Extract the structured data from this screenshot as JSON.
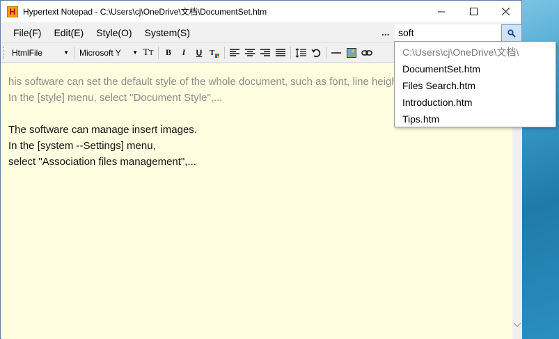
{
  "window": {
    "title": "Hypertext Notepad - C:\\Users\\cj\\OneDrive\\文档\\DocumentSet.htm",
    "icon_letter": "H"
  },
  "menu": [
    "File(F)",
    "Edit(E)",
    "Style(O)",
    "System(S)"
  ],
  "search": {
    "ellipsis": "...",
    "value": "soft"
  },
  "toolbar": {
    "file_type": "HtmlFile",
    "font": "Microsoft Y"
  },
  "content": {
    "lines": [
      "his software can set the default style of the whole document, such as font, line height, etc.",
      "In the [style] menu, select \"Document Style\",...",
      "",
      "The software can manage insert images.",
      "In the [system --Settings] menu,",
      "select \"Association files management\",..."
    ]
  },
  "dropdown": {
    "path": "C:\\Users\\cj\\OneDrive\\文档\\",
    "files": [
      "DocumentSet.htm",
      "Files Search.htm",
      "Introduction.htm",
      "Tips.htm"
    ]
  }
}
